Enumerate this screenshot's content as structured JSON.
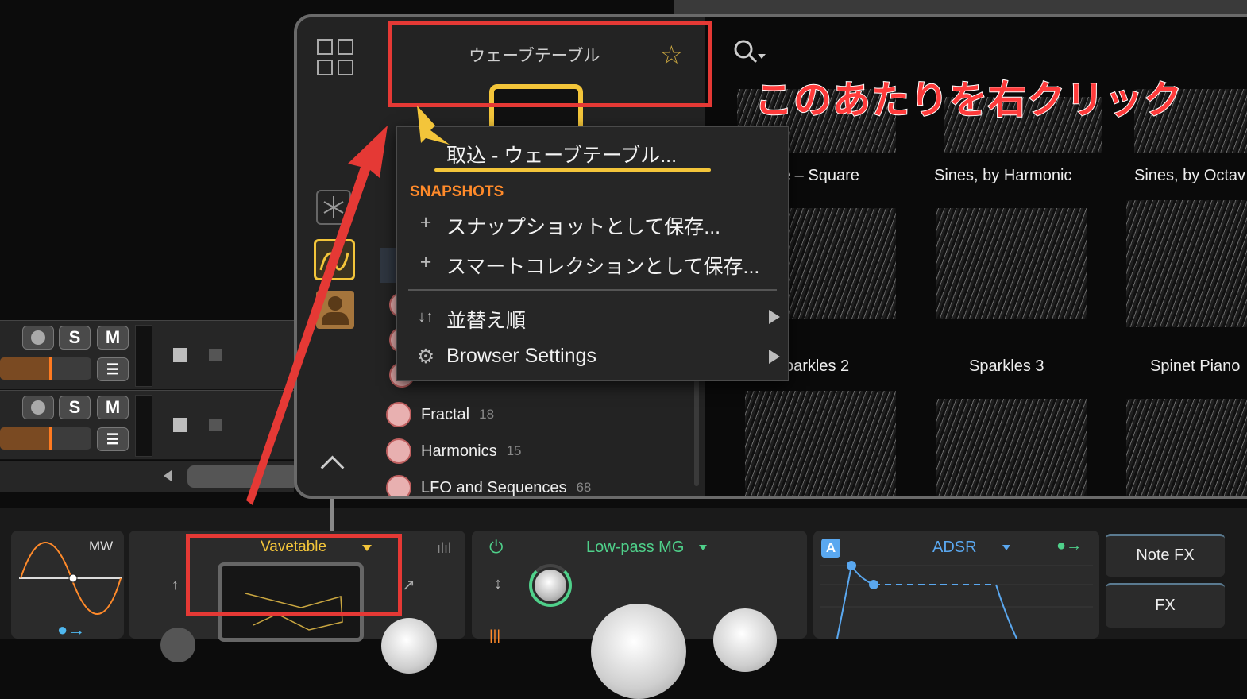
{
  "annotation": {
    "text": "このあたりを右クリック"
  },
  "browser": {
    "selected_category": "ウェーブテーブル",
    "categories": [
      {
        "name": "Fractal",
        "count": "18"
      },
      {
        "name": "Harmonics",
        "count": "15"
      },
      {
        "name": "LFO and Sequences",
        "count": "68"
      }
    ],
    "wavetables": [
      {
        "label": "e – Square"
      },
      {
        "label": "Sines, by Harmonic"
      },
      {
        "label": "Sines, by Octav"
      },
      {
        "label": "parkles 2"
      },
      {
        "label": "Sparkles 3"
      },
      {
        "label": "Spinet Piano"
      }
    ]
  },
  "context_menu": {
    "import_label": "取込 - ウェーブテーブル...",
    "section_title": "SNAPSHOTS",
    "items": [
      {
        "icon": "plus-icon",
        "label": "スナップショットとして保存..."
      },
      {
        "icon": "plus-icon",
        "label": "スマートコレクションとして保存..."
      },
      {
        "icon": "sort-icon",
        "label": "並替え順"
      },
      {
        "icon": "gear-icon",
        "label": "Browser Settings"
      }
    ]
  },
  "mixer": {
    "solo_label": "S",
    "mute_label": "M"
  },
  "devices": {
    "lfo_label": "MW",
    "oscillator_label": "Vavetable",
    "filter_label": "Low-pass MG",
    "envelope_badge": "A",
    "envelope_label": "ADSR",
    "note_fx_label": "Note FX",
    "fx_label": "FX"
  },
  "colors": {
    "annotation_red": "#e53935",
    "accent_yellow": "#f3c53a",
    "section_orange": "#ff8a2a",
    "filter_green": "#4fd08a",
    "envelope_blue": "#5aa8f0"
  }
}
